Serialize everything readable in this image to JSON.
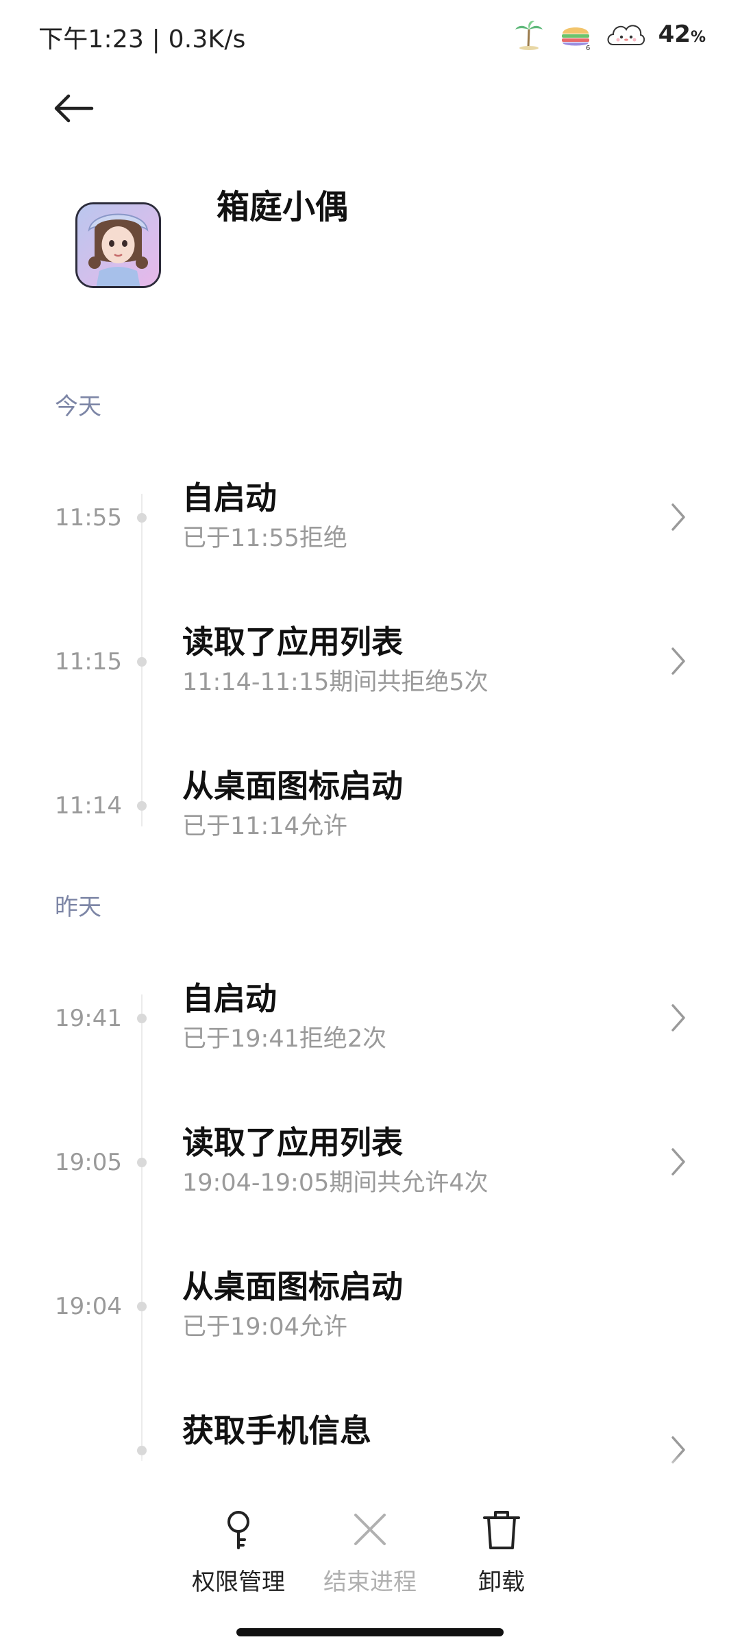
{
  "status_bar": {
    "time_speed": "下午1:23 | 0.3K/s",
    "battery_value": "42",
    "battery_unit": "%",
    "icons": [
      "palm-tree-icon",
      "burger-icon",
      "cloud-face-icon"
    ]
  },
  "header": {
    "back_icon": "arrow-left-icon",
    "app_name": "箱庭小偶"
  },
  "sections": {
    "today": "今天",
    "yesterday": "昨天"
  },
  "records": [
    {
      "time": "11:55",
      "title": "自启动",
      "sub": "已于11:55拒绝",
      "has_chevron": true
    },
    {
      "time": "11:15",
      "title": "读取了应用列表",
      "sub": "11:14-11:15期间共拒绝5次",
      "has_chevron": true
    },
    {
      "time": "11:14",
      "title": "从桌面图标启动",
      "sub": "已于11:14允许",
      "has_chevron": false
    },
    {
      "time": "19:41",
      "title": "自启动",
      "sub": "已于19:41拒绝2次",
      "has_chevron": true
    },
    {
      "time": "19:05",
      "title": "读取了应用列表",
      "sub": "19:04-19:05期间共允许4次",
      "has_chevron": true
    },
    {
      "time": "19:04",
      "title": "从桌面图标启动",
      "sub": "已于19:04允许",
      "has_chevron": false
    },
    {
      "time": "",
      "title": "获取手机信息",
      "sub": "",
      "has_chevron": true
    }
  ],
  "actions": {
    "permissions": "权限管理",
    "end_process": "结束进程",
    "uninstall": "卸载"
  },
  "colors": {
    "section_label": "#7d86a6",
    "muted_text": "#9a9a9a",
    "disabled_text": "#b0b0b0"
  }
}
